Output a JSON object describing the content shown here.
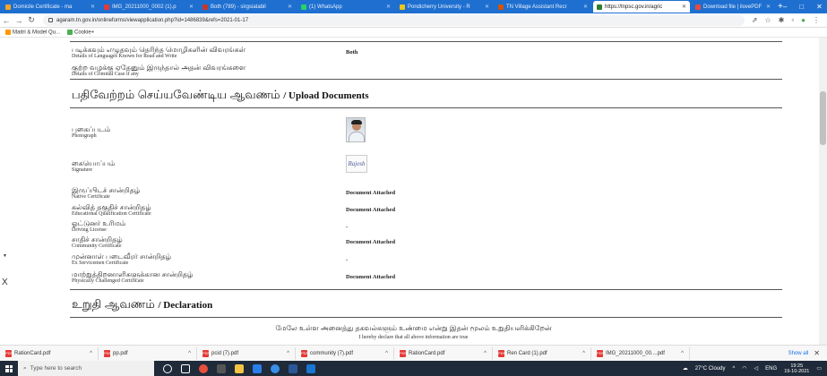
{
  "browser": {
    "tabs": [
      {
        "label": "Domicile Certificate - ma"
      },
      {
        "label": "IMG_20211000_0002 (1).p"
      },
      {
        "label": "Both (789) - sirgsiatabil"
      },
      {
        "label": "(1) WhatsApp"
      },
      {
        "label": "Pondicherry University - R"
      },
      {
        "label": "TN Village Assistant Recr"
      },
      {
        "label": "https://tnpsc.gov.in/agric"
      },
      {
        "label": "Download file | ilovePDF"
      }
    ],
    "url": "agaram.tn.gov.in/onlineforms/viewapplication.php?id=1486839&refs=2021-01-17",
    "bookmarks": [
      {
        "label": "Maitri & Model Qu..."
      },
      {
        "label": "Cookie+"
      }
    ],
    "window_controls": [
      "–",
      "□",
      "✕"
    ]
  },
  "application": {
    "languages_row": {
      "tamil": "படிக்கவும் எழுதவும் தெரிந்த மொழிகளின் விவரங்கள்",
      "english": "Details of Languages Known for Read and Write",
      "value": "Both"
    },
    "criminal_row": {
      "tamil": "குற்ற வழக்கு ஏதேனும் இருந்தால் அதன் விவரங்களை",
      "english": "Details of Criminal Case if any"
    },
    "upload_section": {
      "tamil": "பதிவேற்றம் செய்யவேண்டிய ஆவணம்",
      "english": "/ Upload Documents"
    },
    "documents": [
      {
        "tamil": "புகைப்படம்",
        "english": "Photograph",
        "value": ""
      },
      {
        "tamil": "கையொப்பம்",
        "english": "Signature",
        "value": ""
      },
      {
        "tamil": "இருப்பிடச் சான்றிதழ்",
        "english": "Native Certificate",
        "value": "Document Attached"
      },
      {
        "tamil": "கல்வித் தகுதிச் சான்றிதழ்",
        "english": "Educational Qualification Certificate",
        "value": "Document Attached"
      },
      {
        "tamil": "ஓட்டுனர் உரிமம்",
        "english": "Driving License",
        "value": "-"
      },
      {
        "tamil": "சாதிச் சான்றிதழ்",
        "english": "Community Certificate",
        "value": "Document Attached"
      },
      {
        "tamil": "முன்னாள் படைவீரர் சான்றிதழ்",
        "english": "Ex Servicemen Certificate",
        "value": "-"
      },
      {
        "tamil": "மாற்றுத்திறனாளிகளுக்கான சான்றிதழ்",
        "english": "Physically Challenged Certificate",
        "value": "Document Attached"
      }
    ],
    "declaration_section": {
      "tamil": "உறுதி ஆவணம்",
      "english": "/ Declaration"
    },
    "declaration_text": {
      "tamil": "மேலே உள்ள அனைத்து தகவல்களும் உண்மை என்று இதன் மூலம் உறுதியளிக்கிறேன்",
      "english": "I hereby declare that all above information are true"
    },
    "signature_text": "Rajesh"
  },
  "downloads": {
    "items": [
      {
        "label": "RationCard.pdf"
      },
      {
        "label": "pp.pdf"
      },
      {
        "label": "pcid (7).pdf"
      },
      {
        "label": "community (7).pdf"
      },
      {
        "label": "RationCard.pdf"
      },
      {
        "label": "Ren Card (1).pdf"
      },
      {
        "label": "IMG_20211000_00....pdf"
      }
    ],
    "show_all": "Show all",
    "close": "✕"
  },
  "taskbar": {
    "search_placeholder": "Type here to search",
    "weather": "27°C Cloudy",
    "language": "ENG",
    "time": "19:25",
    "date": "19-10-2021"
  },
  "colors": {
    "chrome_blue": "#1e6fd0",
    "taskbar": "#1f2a3a",
    "pdf_red": "#e53935"
  }
}
